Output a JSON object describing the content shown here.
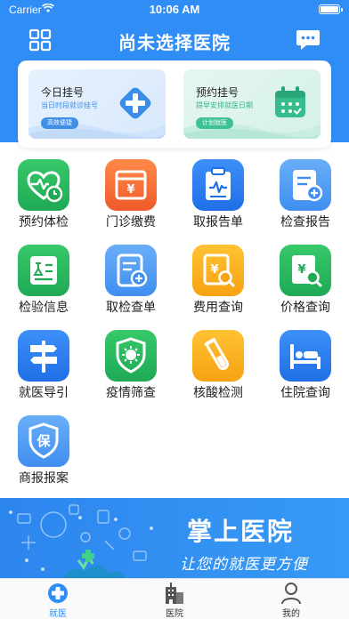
{
  "status_bar": {
    "carrier": "Carrier",
    "time": "10:06 AM"
  },
  "navbar": {
    "title": "尚未选择医院"
  },
  "register": {
    "today": {
      "title": "今日挂号",
      "subtitle": "当日时段就诊挂号",
      "tag": "高效便捷"
    },
    "booking": {
      "title": "预约挂号",
      "subtitle": "提早安排就医日期",
      "tag": "计划就医"
    }
  },
  "services": [
    {
      "label": "预约体检",
      "icon": "heart-clock-icon",
      "color": "green"
    },
    {
      "label": "门诊缴费",
      "icon": "yuan-card-icon",
      "color": "orange"
    },
    {
      "label": "取报告单",
      "icon": "clipboard-pulse-icon",
      "color": "blue"
    },
    {
      "label": "检查报告",
      "icon": "document-plus-icon",
      "color": "lblue"
    },
    {
      "label": "检验信息",
      "icon": "flask-doc-icon",
      "color": "green"
    },
    {
      "label": "取检查单",
      "icon": "document-plus-icon",
      "color": "lblue"
    },
    {
      "label": "费用查询",
      "icon": "yuan-search-icon",
      "color": "yellow"
    },
    {
      "label": "价格查询",
      "icon": "yuan-search-icon",
      "color": "green"
    },
    {
      "label": "就医导引",
      "icon": "signpost-icon",
      "color": "blue"
    },
    {
      "label": "疫情筛查",
      "icon": "virus-shield-icon",
      "color": "green"
    },
    {
      "label": "核酸检测",
      "icon": "test-tube-icon",
      "color": "yellow"
    },
    {
      "label": "住院查询",
      "icon": "hospital-bed-icon",
      "color": "blue"
    },
    {
      "label": "商报报案",
      "icon": "insurance-shield-icon",
      "color": "lblue"
    }
  ],
  "service_glyphs": {
    "fee_yuan": "¥",
    "insurance": "保"
  },
  "banner": {
    "title": "掌上医院",
    "subtitle": "让您的就医更方便"
  },
  "tabbar": [
    {
      "label": "就医",
      "icon": "medical-cross-icon",
      "active": true
    },
    {
      "label": "医院",
      "icon": "hospital-building-icon",
      "active": false
    },
    {
      "label": "我的",
      "icon": "user-icon",
      "active": false
    }
  ],
  "colors": {
    "primary": "#2f8df5",
    "green": "#2fb862",
    "orange": "#f4692f",
    "yellow": "#f9af1f"
  }
}
